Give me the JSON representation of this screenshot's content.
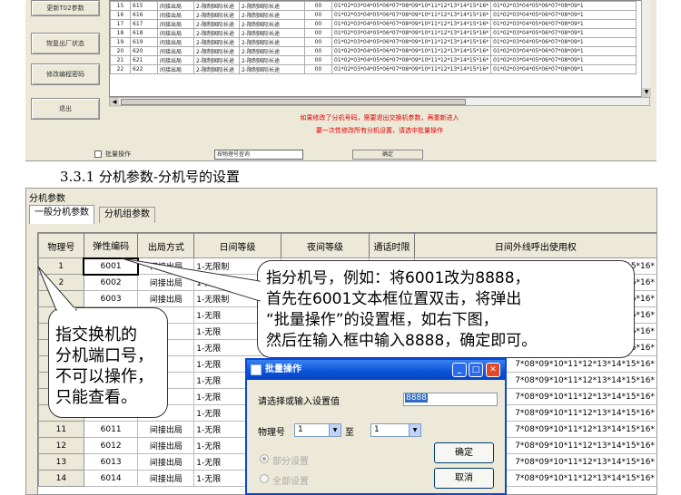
{
  "top_screenshot": {
    "side_buttons": [
      "更新T02参数",
      "恢复出厂状态",
      "修改编程密码",
      "退出"
    ],
    "rows": [
      [
        "15",
        "615",
        "间接出局",
        "2-限制国际长途",
        "2-限制国际长途",
        "00",
        "01*02*03*04*05*06*07*08*09*10*11*12*13*14*15*16*",
        "01*02*03*04*05*06*07*08*09*1"
      ],
      [
        "16",
        "616",
        "间接出局",
        "2-限制国际长途",
        "2-限制国际长途",
        "00",
        "01*02*03*04*05*06*07*08*09*10*11*12*13*14*15*16*",
        "01*02*03*04*05*06*07*08*09*1"
      ],
      [
        "17",
        "617",
        "间接出局",
        "2-限制国际长途",
        "2-限制国际长途",
        "00",
        "01*02*03*04*05*06*07*08*09*10*11*12*13*14*15*16*",
        "01*02*03*04*05*06*07*08*09*1"
      ],
      [
        "18",
        "618",
        "间接出局",
        "2-限制国际长途",
        "2-限制国际长途",
        "00",
        "01*02*03*04*05*06*07*08*09*10*11*12*13*14*15*16*",
        "01*02*03*04*05*06*07*08*09*1"
      ],
      [
        "19",
        "619",
        "间接出局",
        "2-限制国际长途",
        "2-限制国际长途",
        "00",
        "01*02*03*04*05*06*07*08*09*10*11*12*13*14*15*16*",
        "01*02*03*04*05*06*07*08*09*1"
      ],
      [
        "20",
        "620",
        "间接出局",
        "2-限制国际长途",
        "2-限制国际长途",
        "00",
        "01*02*03*04*05*06*07*08*09*10*11*12*13*14*15*16*",
        "01*02*03*04*05*06*07*08*09*1"
      ],
      [
        "21",
        "621",
        "间接出局",
        "2-限制国际长途",
        "2-限制国际长途",
        "00",
        "01*02*03*04*05*06*07*08*09*10*11*12*13*14*15*16*",
        "01*02*03*04*05*06*07*08*09*1"
      ],
      [
        "22",
        "622",
        "间接出局",
        "2-限制国际长途",
        "2-限制国际长途",
        "00",
        "01*02*03*04*05*06*07*08*09*10*11*12*13*14*15*16*",
        "01*02*03*04*05*06*07*08*09*1"
      ]
    ],
    "note_line1": "如果修改了分机号码，需要退出交换机参数，再重新进入",
    "note_line2": "要一次性修改所有分机设置，请选中批量操作",
    "batch_checkbox_label": "批量操作",
    "query_select": "按物理号查询",
    "confirm_button": "确定"
  },
  "section_heading": "3.3.1 分机参数-分机号的设置",
  "group_title": "分机参数",
  "tabs": [
    "一般分机参数",
    "分机组参数"
  ],
  "columns": [
    "物理号",
    "弹性编码",
    "出局方式",
    "日间等级",
    "夜间等级",
    "通话时限",
    "日间外线呼出使用权"
  ],
  "rows": [
    [
      "1",
      "6001",
      "间接出局",
      "1-无限制",
      "",
      "",
      "14*15*16*"
    ],
    [
      "2",
      "6002",
      "间接出局",
      "1-无限制",
      "",
      "",
      "*15*16*"
    ],
    [
      "3",
      "6003",
      "间接出局",
      "1-无限制",
      "",
      "",
      "*15*16*"
    ],
    [
      "4",
      "",
      "",
      "1-无限",
      "",
      "",
      "*15*16*"
    ],
    [
      "5",
      "",
      "",
      "1-无限",
      "",
      "",
      "*15*16*"
    ],
    [
      "6",
      "",
      "",
      "1-无限",
      "",
      "",
      "*15*16*"
    ],
    [
      "7",
      "",
      "",
      "1-无限",
      "",
      "",
      "7*08*09*10*11*12*13*14*15*16*"
    ],
    [
      "8",
      "",
      "",
      "1-无限",
      "",
      "",
      "7*08*09*10*11*12*13*14*15*16*"
    ],
    [
      "9",
      "",
      "",
      "1-无限",
      "",
      "",
      "7*08*09*10*11*12*13*14*15*16*"
    ],
    [
      "10",
      "",
      "",
      "1-无限",
      "",
      "",
      "7*08*09*10*11*12*13*14*15*16*"
    ],
    [
      "11",
      "6011",
      "间接出局",
      "1-无限",
      "",
      "",
      "7*08*09*10*11*12*13*14*15*16*"
    ],
    [
      "12",
      "6012",
      "间接出局",
      "1-无限",
      "",
      "",
      "7*08*09*10*11*12*13*14*15*16*"
    ],
    [
      "13",
      "6013",
      "间接出局",
      "1-无限",
      "",
      "",
      "7*08*09*10*11*12*13*14*15*16*"
    ],
    [
      "14",
      "6014",
      "间接出局",
      "1-无限",
      "",
      "",
      "7*08*09*10*11*12*13*14*15*16*"
    ]
  ],
  "callout_right": {
    "line1": "指分机号，例如：将6001改为8888，",
    "line2": "首先在6001文本框位置双击，将弹出",
    "line3": "“批量操作”的设置框，如右下图，",
    "line4": "然后在输入框中输入8888，确定即可。"
  },
  "callout_left": {
    "line1": "指交换机的",
    "line2": "分机端口号，",
    "line3": "不可以操作，",
    "line4": "只能查看。"
  },
  "dialog": {
    "title": "批量操作",
    "prompt": "请选择或输入设置值",
    "value": "8888",
    "range_label": "物理号",
    "range_from": "1",
    "range_to_label": "至",
    "range_to": "1",
    "radio_partial": "部分设置",
    "radio_all": "全部设置",
    "ok_button": "确定",
    "cancel_button": "取消"
  },
  "colors": {
    "window_bg": "#ece9d8",
    "title_bar": "#0a52d8",
    "note_red": "#e00000",
    "selection": "#316ac5"
  }
}
